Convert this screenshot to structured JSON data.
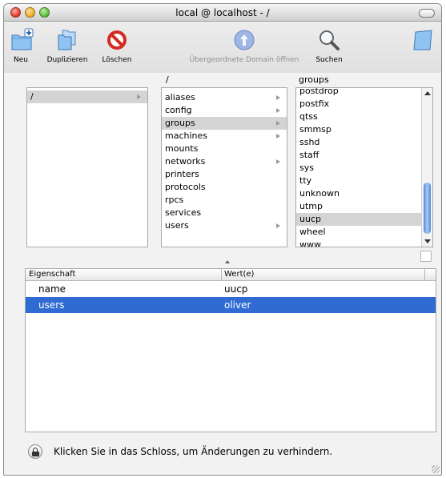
{
  "window": {
    "title": "local @ localhost - /"
  },
  "toolbar": {
    "new_label": "Neu",
    "duplicate_label": "Duplizieren",
    "delete_label": "Löschen",
    "parent_domain_label": "Übergeordnete Domain öffnen",
    "search_label": "Suchen"
  },
  "browser": {
    "col2_header": "/",
    "col3_header": "groups",
    "col1": [
      {
        "label": "/"
      }
    ],
    "col2": [
      {
        "label": "aliases"
      },
      {
        "label": "config"
      },
      {
        "label": "groups"
      },
      {
        "label": "machines"
      },
      {
        "label": "mounts"
      },
      {
        "label": "networks"
      },
      {
        "label": "printers"
      },
      {
        "label": "protocols"
      },
      {
        "label": "rpcs"
      },
      {
        "label": "services"
      },
      {
        "label": "users"
      }
    ],
    "col3": [
      {
        "label": "postdrop"
      },
      {
        "label": "postfix"
      },
      {
        "label": "qtss"
      },
      {
        "label": "smmsp"
      },
      {
        "label": "sshd"
      },
      {
        "label": "staff"
      },
      {
        "label": "sys"
      },
      {
        "label": "tty"
      },
      {
        "label": "unknown"
      },
      {
        "label": "utmp"
      },
      {
        "label": "uucp"
      },
      {
        "label": "wheel"
      },
      {
        "label": "www"
      }
    ]
  },
  "properties": {
    "col_property": "Eigenschaft",
    "col_value": "Wert(e)",
    "rows": [
      {
        "property": "name",
        "value": "uucp"
      },
      {
        "property": "users",
        "value": "oliver"
      }
    ]
  },
  "lock": {
    "text": "Klicken Sie in das Schloss, um Änderungen zu verhindern."
  },
  "colors": {
    "selection": "#2f6bd3",
    "browser_selection": "#d4d4d4"
  },
  "icons": {
    "new": "new-folder-icon",
    "duplicate": "duplicate-icon",
    "delete": "delete-icon",
    "parent_domain": "globe-icon",
    "search": "magnifier-icon",
    "folder": "folder-icon"
  }
}
